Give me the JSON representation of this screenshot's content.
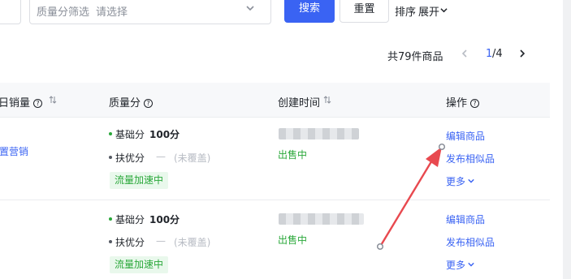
{
  "filter": {
    "quality_label": "质量分筛选",
    "quality_placeholder": "请选择",
    "search_button": "搜索",
    "reset_button": "重置",
    "sort_label": "排序",
    "expand_label": "展开"
  },
  "pagination": {
    "total": "共79件商品",
    "current": "1",
    "separator": "/4"
  },
  "table": {
    "columns": {
      "sales": "日销量",
      "quality": "质量分",
      "created": "创建时间",
      "actions": "操作"
    },
    "help_glyph": "?",
    "rows": [
      {
        "sales_action": "置营销",
        "base_label": "基础分",
        "base_score": "100分",
        "boost_label": "扶优分",
        "boost_dash": "—",
        "boost_status": "(未覆盖)",
        "traffic_tag": "流量加速中",
        "status": "出售中",
        "edit": "编辑商品",
        "publish_similar": "发布相似品",
        "more": "更多"
      },
      {
        "base_label": "基础分",
        "base_score": "100分",
        "boost_label": "扶优分",
        "boost_dash": "—",
        "boost_status": "(未覆盖)",
        "traffic_tag": "流量加速中",
        "status": "出售中",
        "edit": "编辑商品",
        "publish_similar": "发布相似品",
        "more": "更多"
      }
    ]
  },
  "colors": {
    "primary": "#3a63f3",
    "success": "#2aa83a",
    "success_bg": "#e9f8ec",
    "annotation": "#e8494f"
  },
  "icons": [
    "chevron-down-icon",
    "sort-icon",
    "help-icon",
    "chevron-left-icon",
    "chevron-right-icon",
    "annotation-arrow"
  ]
}
